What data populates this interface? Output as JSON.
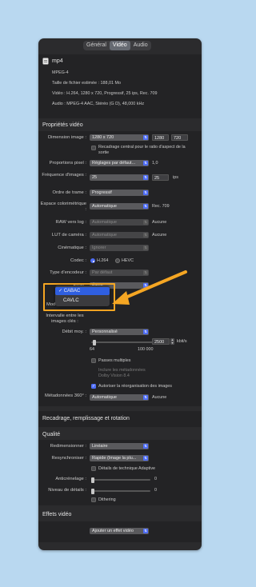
{
  "tabs": [
    "Général",
    "Vidéo",
    "Audio"
  ],
  "file": {
    "icon": "document-icon",
    "name": "mp4",
    "format": "MPEG-4",
    "size": "Taille de fichier estimée : 188,01 Mo",
    "video": "Vidéo : H.264, 1280 x 720, Progressif, 25 ips, Rec. 709",
    "audio": "Audio : MPEG-4 AAC, Stéréo (G D), 48,000 kHz"
  },
  "video_props": {
    "title": "Propriétés vidéo",
    "dimension_label": "Dimension image :",
    "dimension_value": "1280 x 720",
    "width": "1280",
    "height": "720",
    "crop_check": "Recadrage central pour le ratio d'aspect de la sortie",
    "pixel_label": "Proportions pixel :",
    "pixel_value": "Réglages par défaut...",
    "pixel_ratio": "1,0",
    "fps_label": "Fréquence d'images :",
    "fps_value": "25",
    "fps_field": "25",
    "fps_unit": "ips",
    "field_order_label": "Ordre de trame :",
    "field_order_value": "Progressif",
    "color_label": "Espace colorimétrique :",
    "color_value": "Automatique",
    "color_note": "Rec. 709",
    "raw_label": "RAW vers log :",
    "raw_value": "Automatique",
    "raw_note": "Aucune",
    "lut_label": "LUT de caméra :",
    "lut_value": "Automatique",
    "lut_note": "Aucune",
    "cinematic_label": "Cinématique :",
    "cinematic_value": "Ignorer",
    "codec_label": "Codec :",
    "codec_h264": "H.264",
    "codec_hevc": "HEVC",
    "encoder_label": "Type d'encodeur :",
    "encoder_value": "Par défaut",
    "profile_label": "Profil :",
    "profile_value": "Élevé",
    "entropy_label": "Mode Entropie :",
    "entropy_options": [
      "CABAC",
      "CAVLC"
    ],
    "entropy_selected_mark": "✓",
    "keyframe_label": "Intervalle entre les images clés :",
    "bitrate_label": "Débit moy. :",
    "bitrate_value": "Personnalisé",
    "bitrate_field": "2500",
    "bitrate_unit": "kbit/s",
    "slider_min": "64",
    "slider_max": "100 000",
    "bitrate_fraction": 0.02,
    "multipass": "Passes multiples",
    "dolby_note": "Inclure les métadonnées Dolby Vision 8.4",
    "reorder": "Autoriser la réorganisation des images",
    "meta360_label": "Métadonnées 360° :",
    "meta360_value": "Automatique",
    "meta360_note": "Aucune"
  },
  "crop_section": {
    "title": "Recadrage, remplissage et rotation"
  },
  "quality": {
    "title": "Qualité",
    "resize_label": "Redimensionner :",
    "resize_value": "Linéaire",
    "resample_label": "Resynchroniser :",
    "resample_value": "Rapide (Image la plu...",
    "adaptive": "Détails de technique Adaptive",
    "antialias_label": "Anticrénelage :",
    "antialias_value": "0",
    "antialias_fraction": 0.0,
    "detail_label": "Niveau de détails :",
    "detail_value": "0",
    "detail_fraction": 0.0,
    "dithering": "Dithering"
  },
  "effects": {
    "title": "Effets vidéo",
    "add_value": "Ajouter un effet vidéo"
  },
  "colors": {
    "background": "#b9d8f0",
    "window": "#2b2b2d",
    "accent": "#4f6ef7",
    "highlight": "#f5a623"
  }
}
